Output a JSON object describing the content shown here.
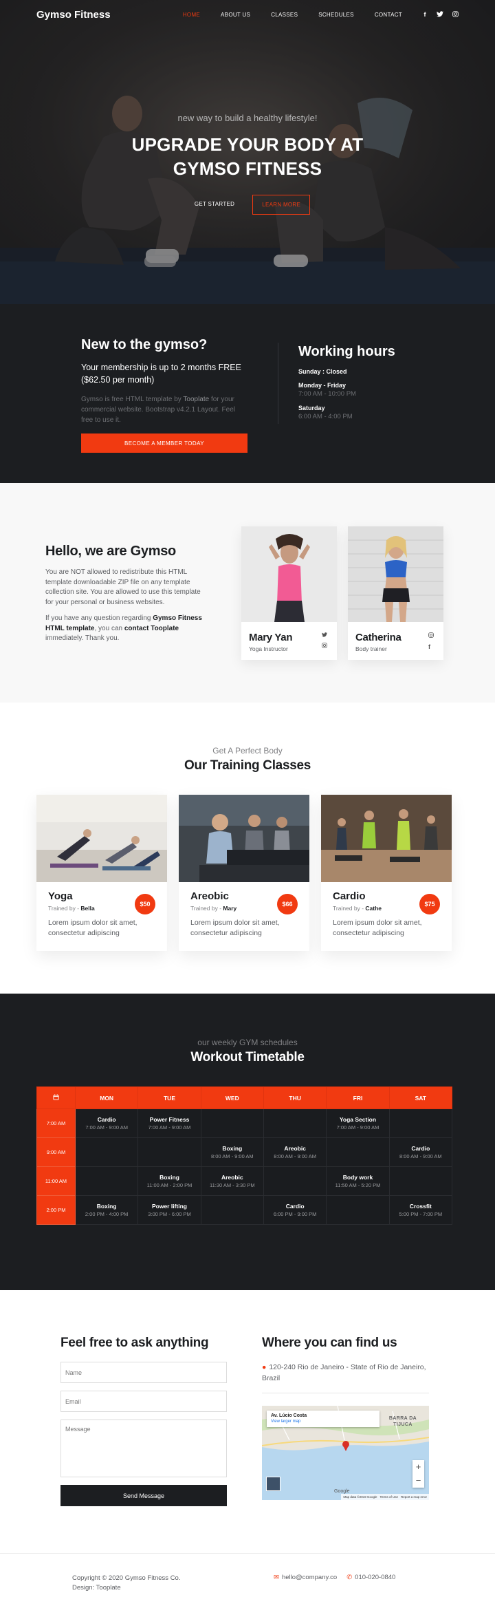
{
  "navbar": {
    "brand": "Gymso Fitness",
    "items": [
      {
        "label": "HOME",
        "active": true
      },
      {
        "label": "ABOUT US",
        "active": false
      },
      {
        "label": "CLASSES",
        "active": false
      },
      {
        "label": "SCHEDULES",
        "active": false
      },
      {
        "label": "CONTACT",
        "active": false
      }
    ],
    "social": [
      {
        "icon": "facebook-icon",
        "glyph": "f"
      },
      {
        "icon": "twitter-icon",
        "glyph": "t"
      },
      {
        "icon": "instagram-icon",
        "glyph": "◎"
      }
    ]
  },
  "hero": {
    "subtitle": "new way to build a healthy lifestyle!",
    "title_line1": "UPGRADE YOUR BODY AT",
    "title_line2": "GYMSO FITNESS",
    "btn_primary": "GET STARTED",
    "btn_secondary": "LEARN MORE"
  },
  "membership": {
    "title": "New to the gymso?",
    "lead": "Your membership is up to 2 months FREE ($62.50 per month)",
    "text_before_link": "Gymso is free HTML template by ",
    "link": "Tooplate",
    "text_after_link": " for your commercial website. Bootstrap v4.2.1 Layout. Feel free to use it.",
    "cta": "BECOME A MEMBER TODAY"
  },
  "hours": {
    "title": "Working hours",
    "items": [
      {
        "day": "Sunday : Closed",
        "time": ""
      },
      {
        "day": "Monday - Friday",
        "time": "7:00 AM - 10:00 PM"
      },
      {
        "day": "Saturday",
        "time": "6:00 AM - 4:00 PM"
      }
    ]
  },
  "about": {
    "title": "Hello, we are Gymso",
    "para1": "You are NOT allowed to redistribute this HTML template downloadable ZIP file on any template collection site. You are allowed to use this template for your personal or business websites.",
    "para2_a": "If you have any question regarding ",
    "para2_b": "Gymso Fitness HTML template",
    "para2_c": ", you can ",
    "para2_d": "contact Tooplate",
    "para2_e": " immediately. Thank you.",
    "team": [
      {
        "name": "Mary Yan",
        "role": "Yoga Instructor",
        "icons": [
          "twitter-icon",
          "instagram-icon"
        ]
      },
      {
        "name": "Catherina",
        "role": "Body trainer",
        "icons": [
          "instagram-icon",
          "facebook-icon"
        ]
      }
    ]
  },
  "classes": {
    "subtitle": "Get A Perfect Body",
    "title": "Our Training Classes",
    "trained_by": "Trained by -",
    "items": [
      {
        "name": "Yoga",
        "trainer": "Bella",
        "price": "$50",
        "desc": "Lorem ipsum dolor sit amet, consectetur adipiscing"
      },
      {
        "name": "Areobic",
        "trainer": "Mary",
        "price": "$66",
        "desc": "Lorem ipsum dolor sit amet, consectetur adipiscing"
      },
      {
        "name": "Cardio",
        "trainer": "Cathe",
        "price": "$75",
        "desc": "Lorem ipsum dolor sit amet, consectetur adipiscing"
      }
    ]
  },
  "schedule": {
    "subtitle": "our weekly GYM schedules",
    "title": "Workout Timetable",
    "days": [
      "MON",
      "TUE",
      "WED",
      "THU",
      "FRI",
      "SAT"
    ],
    "rows": [
      {
        "time": "7:00 AM",
        "cells": [
          {
            "title": "Cardio",
            "time": "7:00 AM - 9:00 AM"
          },
          {
            "title": "Power Fitness",
            "time": "7:00 AM - 9:00 AM"
          },
          null,
          null,
          {
            "title": "Yoga Section",
            "time": "7:00 AM - 9:00 AM"
          },
          null
        ]
      },
      {
        "time": "9:00 AM",
        "cells": [
          null,
          null,
          {
            "title": "Boxing",
            "time": "8:00 AM - 9:00 AM"
          },
          {
            "title": "Areobic",
            "time": "8:00 AM - 9:00 AM"
          },
          null,
          {
            "title": "Cardio",
            "time": "8:00 AM - 9:00 AM"
          }
        ]
      },
      {
        "time": "11:00 AM",
        "cells": [
          null,
          {
            "title": "Boxing",
            "time": "11:00 AM - 2:00 PM"
          },
          {
            "title": "Areobic",
            "time": "11:30 AM - 3:30 PM"
          },
          null,
          {
            "title": "Body work",
            "time": "11:50 AM - 5:20 PM"
          },
          null
        ]
      },
      {
        "time": "2:00 PM",
        "cells": [
          {
            "title": "Boxing",
            "time": "2:00 PM - 4:00 PM"
          },
          {
            "title": "Power lifting",
            "time": "3:00 PM - 6:00 PM"
          },
          null,
          {
            "title": "Cardio",
            "time": "6:00 PM - 9:00 PM"
          },
          null,
          {
            "title": "Crossfit",
            "time": "5:00 PM - 7:00 PM"
          }
        ]
      }
    ]
  },
  "contact": {
    "title": "Feel free to ask anything",
    "name_placeholder": "Name",
    "email_placeholder": "Email",
    "message_placeholder": "Message",
    "send": "Send Message"
  },
  "location": {
    "title": "Where you can find us",
    "address": "120-240 Rio de Janeiro - State of Rio de Janeiro, Brazil",
    "map_place": "Av. Lúcio Costa",
    "map_link": "View larger map",
    "map_area": "BARRA DA TIJUCA",
    "map_brand": "Google",
    "map_attribution": [
      "Map data ©2019 Google",
      "Terms of Use",
      "Report a map error"
    ]
  },
  "footer": {
    "copyright": "Copyright © 2020 Gymso Fitness Co.",
    "design": "Design: Tooplate",
    "email": "hello@company.co",
    "phone": "010-020-0840"
  },
  "colors": {
    "accent": "#f13a11",
    "dark": "#1c1e21",
    "light": "#f8f8f8"
  }
}
